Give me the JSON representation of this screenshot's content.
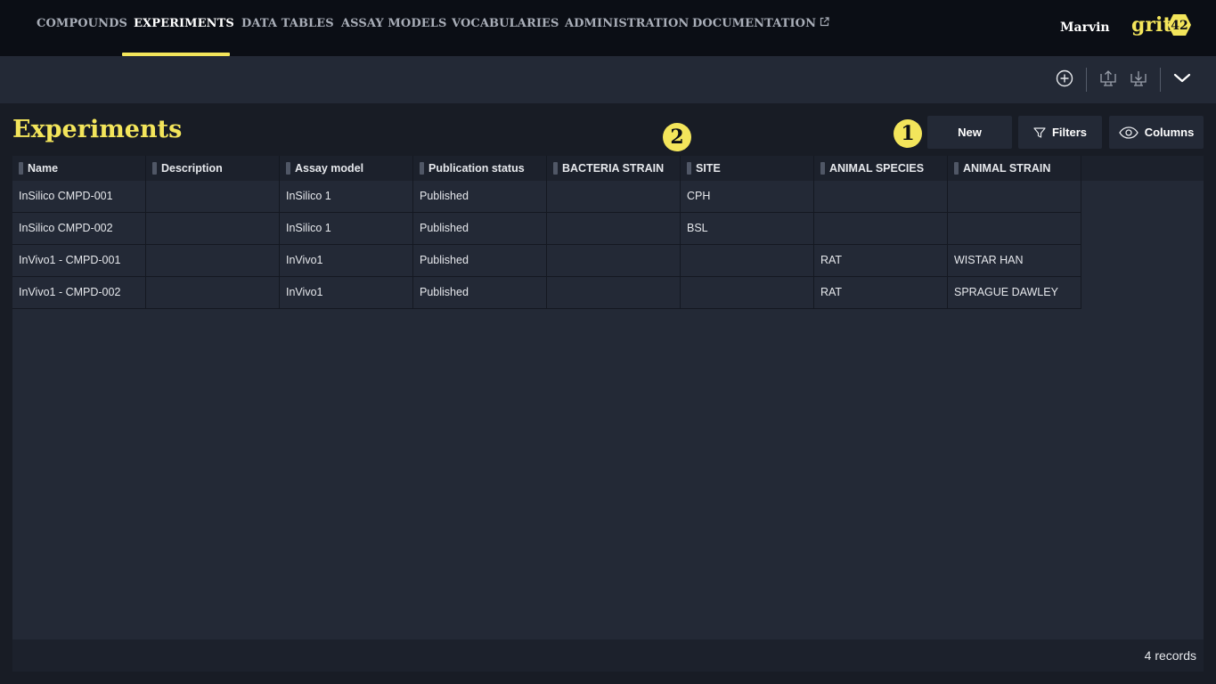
{
  "nav": {
    "items": [
      {
        "label": "COMPOUNDS",
        "active": false
      },
      {
        "label": "EXPERIMENTS",
        "active": true
      },
      {
        "label": "DATA TABLES",
        "active": false
      },
      {
        "label": "ASSAY MODELS",
        "active": false
      },
      {
        "label": "VOCABULARIES",
        "active": false
      },
      {
        "label": "ADMINISTRATION",
        "active": false
      },
      {
        "label": "DOCUMENTATION",
        "active": false,
        "icon": "external-link-icon"
      }
    ],
    "user": "Marvin",
    "logo": {
      "text": "grit",
      "badge": "42"
    }
  },
  "toolbar": {
    "icons": [
      "add-circle-icon",
      "upload-icon",
      "download-icon",
      "chevron-down-icon"
    ]
  },
  "page": {
    "title": "Experiments",
    "badges": [
      "1",
      "2"
    ],
    "actions": {
      "new_label": "New",
      "filters_label": "Filters",
      "columns_label": "Columns"
    }
  },
  "table": {
    "columns": [
      "Name",
      "Description",
      "Assay model",
      "Publication status",
      "BACTERIA STRAIN",
      "SITE",
      "ANIMAL SPECIES",
      "ANIMAL STRAIN"
    ],
    "rows": [
      [
        "InSilico CMPD-001",
        "",
        "InSilico 1",
        "Published",
        "",
        "CPH",
        "",
        ""
      ],
      [
        "InSilico CMPD-002",
        "",
        "InSilico 1",
        "Published",
        "",
        "BSL",
        "",
        ""
      ],
      [
        "InVivo1 - CMPD-001",
        "",
        "InVivo1",
        "Published",
        "",
        "",
        "RAT",
        "WISTAR HAN"
      ],
      [
        "InVivo1 - CMPD-002",
        "",
        "InVivo1",
        "Published",
        "",
        "",
        "RAT",
        "SPRAGUE DAWLEY"
      ]
    ],
    "footer": "4 records"
  },
  "colors": {
    "accent": "#f3e55b",
    "nav_bg": "#0b0e15",
    "toolbar_bg": "#232936",
    "page_bg": "#181c25"
  }
}
